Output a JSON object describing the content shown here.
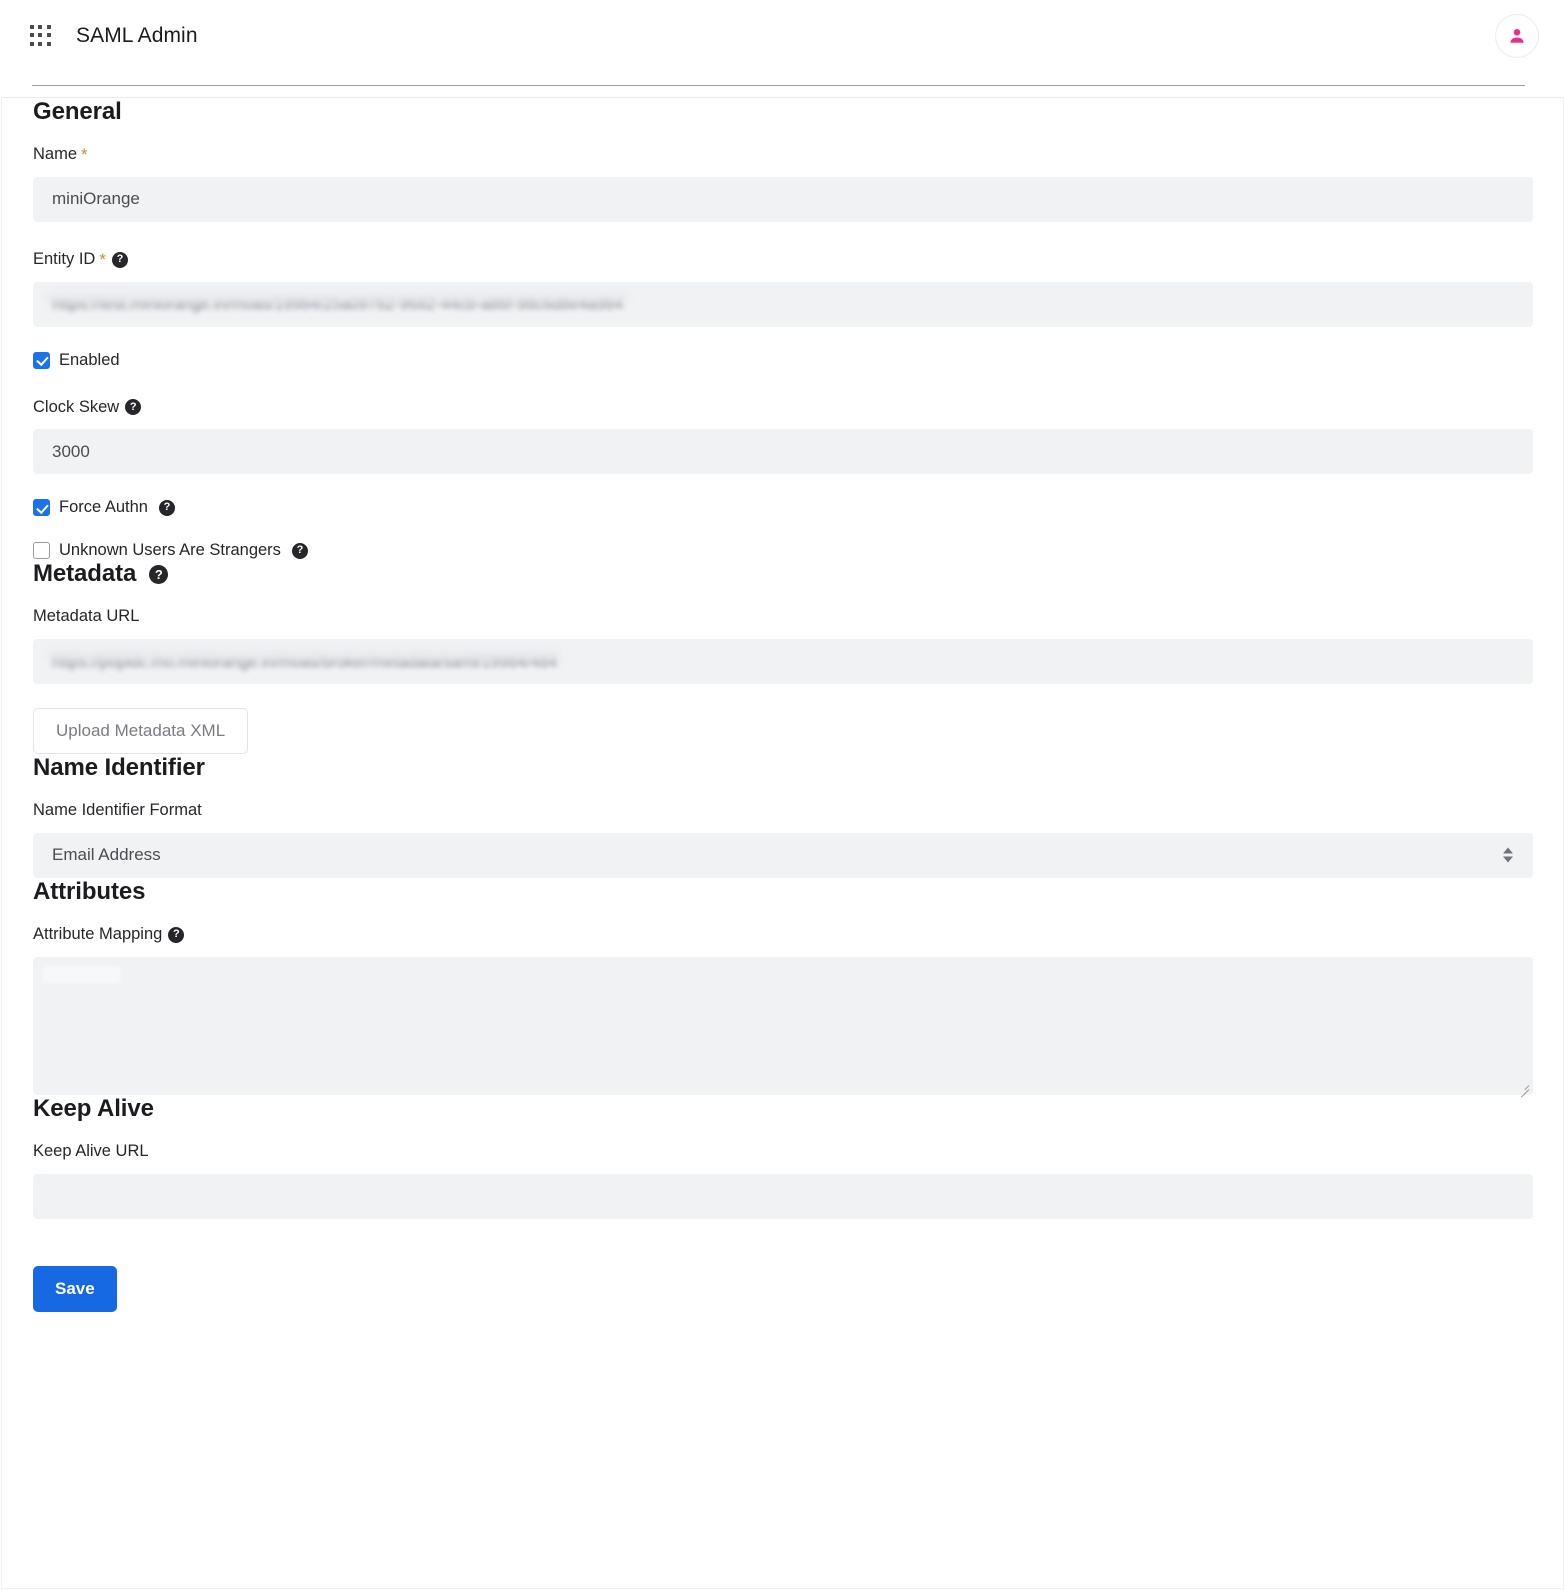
{
  "header": {
    "app_title": "SAML Admin",
    "grid_icon": "apps-grid-icon",
    "avatar_icon": "user-avatar-icon"
  },
  "sections": {
    "general": {
      "title": "General",
      "name": {
        "label": "Name",
        "required_marker": "*",
        "value": "miniOrange"
      },
      "entity_id": {
        "label": "Entity ID",
        "required_marker": "*",
        "help_icon": "help-circle-icon",
        "value": "https://test.miniorange.in/moas/19984/25a09762-9682-44cb-a86f-98c6d8e4a984"
      },
      "enabled": {
        "label": "Enabled",
        "checked": true
      },
      "clock_skew": {
        "label": "Clock Skew",
        "help_icon": "help-circle-icon",
        "value": "3000"
      },
      "force_authn": {
        "label": "Force Authn",
        "help_icon": "help-circle-icon",
        "checked": true
      },
      "unknown_users": {
        "label": "Unknown Users Are Strangers",
        "help_icon": "help-circle-icon",
        "checked": false
      }
    },
    "metadata": {
      "title": "Metadata",
      "help_icon": "help-circle-icon",
      "url": {
        "label": "Metadata URL",
        "value": "https://popidc.mo.miniorange.in/moas/broker/metadata/saml/19984/484"
      },
      "upload_button": "Upload Metadata XML"
    },
    "name_identifier": {
      "title": "Name Identifier",
      "format": {
        "label": "Name Identifier Format",
        "selected": "Email Address",
        "options": [
          "Email Address"
        ]
      }
    },
    "attributes": {
      "title": "Attributes",
      "mapping": {
        "label": "Attribute Mapping",
        "help_icon": "help-circle-icon",
        "value": ""
      }
    },
    "keep_alive": {
      "title": "Keep Alive",
      "url": {
        "label": "Keep Alive URL",
        "value": ""
      }
    }
  },
  "footer": {
    "save_label": "Save"
  },
  "colors": {
    "primary": "#1668e3",
    "checkbox_checked": "#1a73e8",
    "required_asterisk": "#c98b3a",
    "avatar": "#e8308a",
    "input_background": "#f1f2f4"
  }
}
